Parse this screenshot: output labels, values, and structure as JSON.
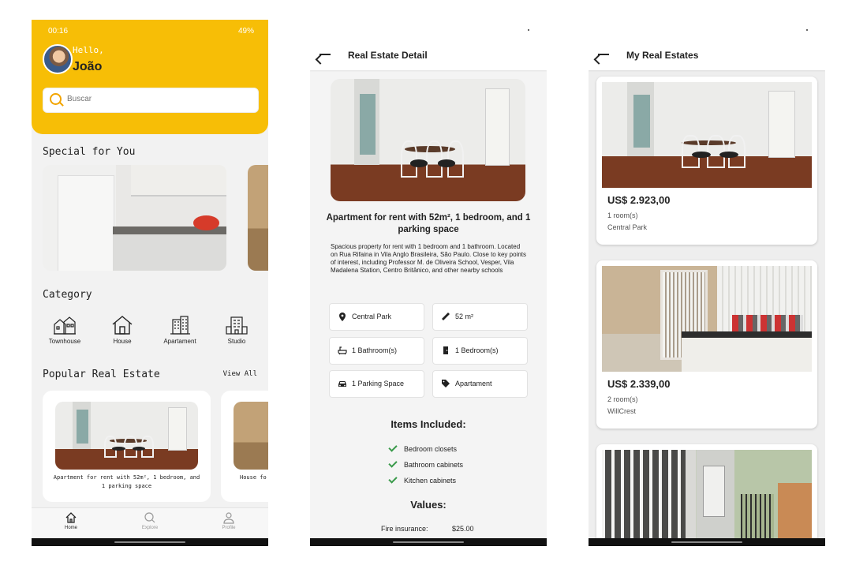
{
  "screen_home": {
    "status_time": "00:16",
    "status_battery": "49%",
    "greeting": "Hello,",
    "user_name": "João",
    "search_placeholder": "Buscar",
    "special_title": "Special for You",
    "category_title": "Category",
    "categories": [
      {
        "label": "Townhouse",
        "icon": "townhouse-icon"
      },
      {
        "label": "House",
        "icon": "house-icon"
      },
      {
        "label": "Apartament",
        "icon": "apartment-building-icon"
      },
      {
        "label": "Studio",
        "icon": "studio-icon"
      }
    ],
    "popular_title": "Popular Real Estate",
    "view_all": "View All",
    "popular_cards": [
      {
        "caption": "Apartment for rent with 52m², 1 bedroom, and 1 parking space"
      },
      {
        "caption": "House fo"
      }
    ],
    "nav": [
      {
        "label": "Home",
        "icon": "home-icon",
        "active": true
      },
      {
        "label": "Explore",
        "icon": "search-icon",
        "active": false
      },
      {
        "label": "Profile",
        "icon": "user-icon",
        "active": false
      }
    ],
    "accent_color": "#F7BE06"
  },
  "screen_detail": {
    "title": "Real Estate Detail",
    "heading": "Apartment for rent with 52m², 1 bedroom, and 1 parking space",
    "description": "Spacious property for rent with 1 bedroom and 1 bathroom. Located on Rua Rifaina in Vila Anglo Brasileira, São Paulo. Close to key points of interest, including Professor M. de Oliveira School, Vesper, Vila Madalena Station, Centro Britânico, and other nearby schools",
    "features": [
      {
        "label": "Central Park",
        "icon": "location-pin-icon"
      },
      {
        "label": "52 m²",
        "icon": "ruler-icon"
      },
      {
        "label": "1 Bathroom(s)",
        "icon": "bathtub-icon"
      },
      {
        "label": "1 Bedroom(s)",
        "icon": "door-icon"
      },
      {
        "label": "1 Parking Space",
        "icon": "car-icon"
      },
      {
        "label": "Apartament",
        "icon": "tag-icon"
      }
    ],
    "items_title": "Items Included:",
    "items": [
      "Bedroom closets",
      "Bathroom cabinets",
      "Kitchen cabinets"
    ],
    "values_title": "Values:",
    "values": [
      {
        "label": "Fire insurance:",
        "value": "$25.00"
      }
    ],
    "check_color": "#3A9A4B"
  },
  "screen_list": {
    "title": "My Real Estates",
    "listings": [
      {
        "price": "US$ 2.923,00",
        "rooms": "1 room(s)",
        "location": "Central Park"
      },
      {
        "price": "US$ 2.339,00",
        "rooms": "2 room(s)",
        "location": "WillCrest"
      }
    ]
  }
}
